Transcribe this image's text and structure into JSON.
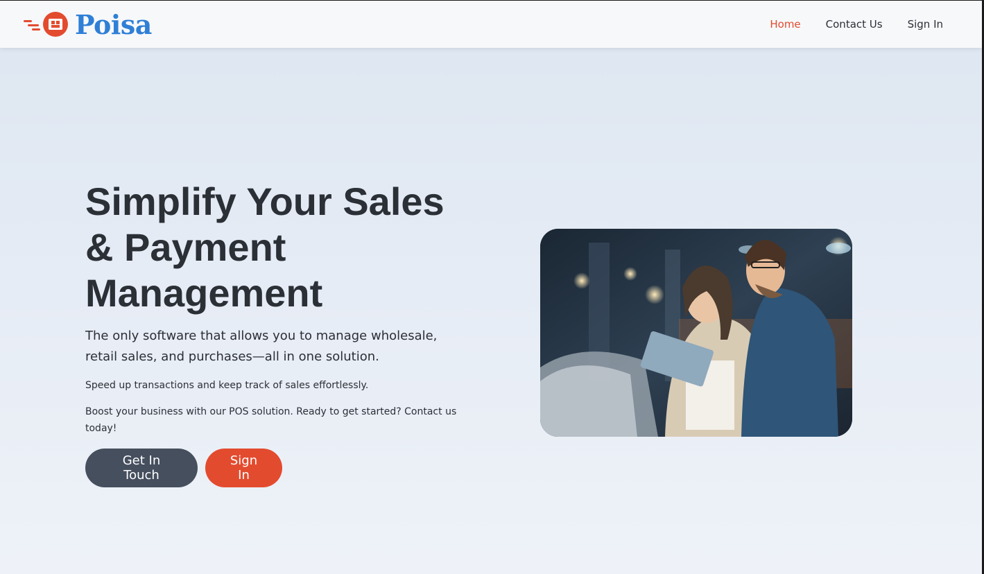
{
  "brand": {
    "name": "Poisa",
    "accent": "#e34b2f",
    "brand_blue": "#2f7fd6"
  },
  "nav": {
    "items": [
      {
        "label": "Home",
        "active": true
      },
      {
        "label": "Contact Us",
        "active": false
      },
      {
        "label": "Sign In",
        "active": false
      }
    ]
  },
  "hero": {
    "title_line1": "Simplify Your Sales",
    "title_line2": "& Payment",
    "title_line3": "Management",
    "lead": "The only software that allows you to manage wholesale, retail sales, and purchases—all in one solution.",
    "p1": "Speed up transactions and keep track of sales effortlessly.",
    "p2": "Boost your business with our POS solution. Ready to get started? Contact us today!",
    "cta_primary": "Get In Touch",
    "cta_secondary": "Sign In"
  },
  "icons": {
    "logo": "delivery-box-icon"
  }
}
